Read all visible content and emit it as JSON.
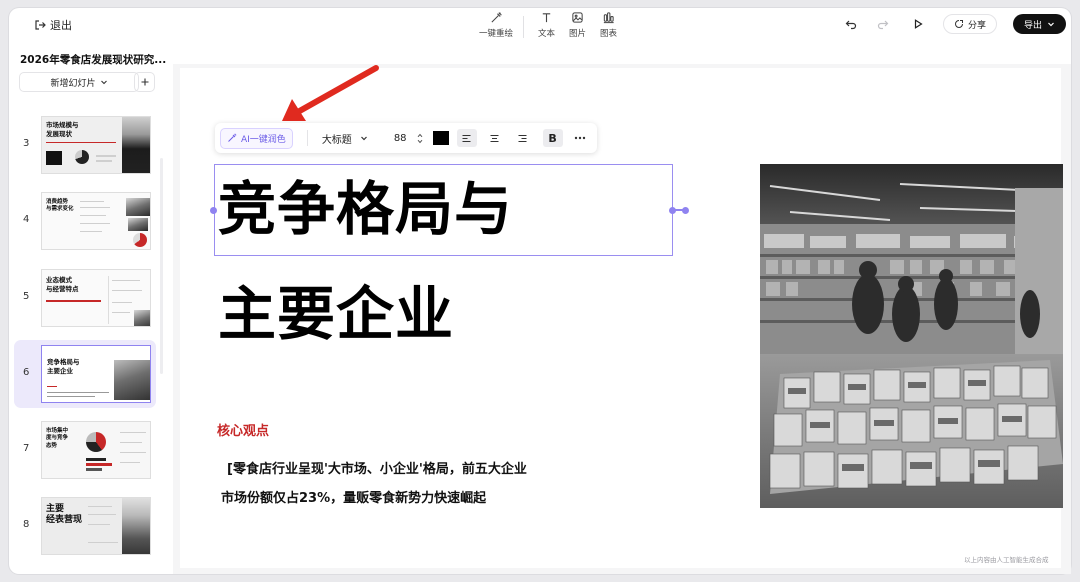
{
  "topbar": {
    "exit_label": "退出",
    "tools": [
      {
        "label": "一键重绘",
        "icon": "magic-brush-icon"
      },
      {
        "label": "文本",
        "icon": "text-icon"
      },
      {
        "label": "图片",
        "icon": "image-icon"
      },
      {
        "label": "图表",
        "icon": "chart-icon"
      }
    ],
    "share_label": "分享",
    "export_label": "导出"
  },
  "sidebar": {
    "doc_title": "2026年零食店发展现状研究...",
    "new_slide_label": "新增幻灯片",
    "slides": [
      {
        "num": "3",
        "title": "市场规模与发展现状",
        "active": false
      },
      {
        "num": "4",
        "title": "消费趋势与需求变化",
        "active": false
      },
      {
        "num": "5",
        "title": "业态模式与经营特点",
        "active": false
      },
      {
        "num": "6",
        "title": "竞争格局与主要企业",
        "active": true
      },
      {
        "num": "7",
        "title": "市场集中度与竞争态势",
        "active": false
      },
      {
        "num": "8",
        "title": "主要经营表现",
        "active": false
      }
    ]
  },
  "format_toolbar": {
    "ai_label": "AI一键润色",
    "text_style": "大标题",
    "font_size": "88",
    "text_color": "#000000",
    "bold_label": "B"
  },
  "slide": {
    "title_line1": "竞争格局与",
    "title_line2": "主要企业",
    "core_label": "核心观点",
    "body_line1": "[零食店行业呈现'大市场、小企业'格局，前五大企业",
    "body_line2": "市场份额仅占23%，量贩零食新势力快速崛起",
    "footer_note": "以上内容由人工智能生成合成"
  },
  "colors": {
    "accent": "#8f83f0",
    "brand_red": "#c62828",
    "annotation_arrow": "#e02a1f",
    "export_bg": "#111111"
  }
}
